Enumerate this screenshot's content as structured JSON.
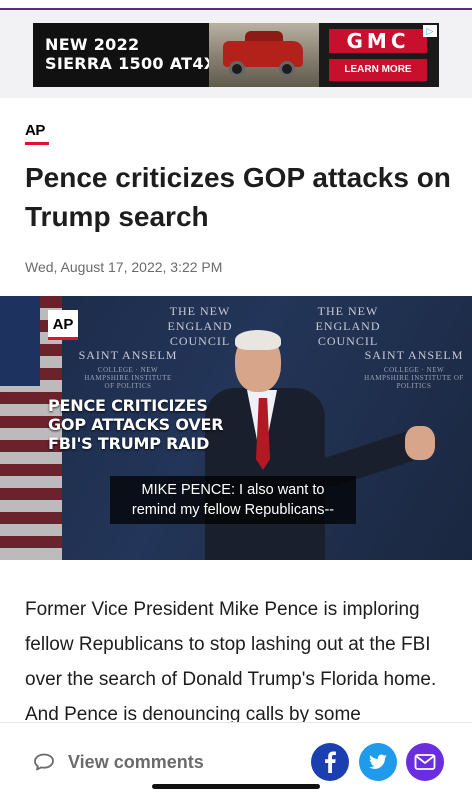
{
  "ad": {
    "headline": "NEW 2022\nSIERRA 1500 AT4X",
    "brand": "GMC",
    "cta": "LEARN MORE",
    "brand_color": "#c8102e"
  },
  "article": {
    "source": "AP",
    "headline": "Pence criticizes GOP attacks on Trump search",
    "date": "Wed, August 17, 2022, 3:22 PM",
    "body": "Former Vice President Mike Pence is imploring fellow Republicans to stop lashing out at the FBI over the search of Donald Trump's Florida home. And Pence is denouncing calls by some"
  },
  "video": {
    "badge": "AP",
    "overlay_title": "PENCE CRITICIZES GOP ATTACKS OVER FBI'S TRUMP RAID",
    "caption": "MIKE PENCE: I also want to remind my fellow Republicans--",
    "backdrop": {
      "council_1": "THE NEW ENGLAND COUNCIL",
      "council_2": "THE NEW ENGLAND COUNCIL",
      "college_1": "SAINT ANSELM",
      "college_sub_1": "COLLEGE · NEW HAMPSHIRE INSTITUTE OF POLITICS",
      "college_2": "SAINT ANSELM",
      "college_sub_2": "COLLEGE · NEW HAMPSHIRE INSTITUTE OF POLITICS"
    }
  },
  "bottom_bar": {
    "comments_label": "View comments",
    "share_icons": [
      "facebook-icon",
      "twitter-icon",
      "mail-icon"
    ],
    "colors": {
      "facebook": "#1b3fb0",
      "twitter": "#1e9bea",
      "mail": "#6a2ee0"
    }
  }
}
